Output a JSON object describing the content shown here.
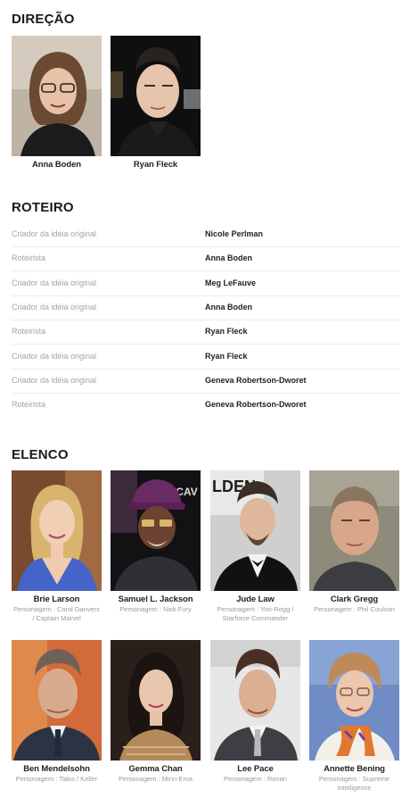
{
  "direction": {
    "title": "DIREÇÃO",
    "people": [
      {
        "name": "Anna Boden"
      },
      {
        "name": "Ryan Fleck"
      }
    ]
  },
  "screenplay": {
    "title": "ROTEIRO",
    "rows": [
      {
        "role": "Criador da idéia original",
        "name": "Nicole Perlman"
      },
      {
        "role": "Roteirista",
        "name": "Anna Boden"
      },
      {
        "role": "Criador da idéia original",
        "name": "Meg LeFauve"
      },
      {
        "role": "Criador da idéia original",
        "name": "Anna Boden"
      },
      {
        "role": "Roteirista",
        "name": "Ryan Fleck"
      },
      {
        "role": "Criador da idéia original",
        "name": "Ryan Fleck"
      },
      {
        "role": "Criador da idéia original",
        "name": "Geneva Robertson-Dworet"
      },
      {
        "role": "Roteirista",
        "name": "Geneva Robertson-Dworet"
      }
    ]
  },
  "cast": {
    "title": "ELENCO",
    "members": [
      {
        "name": "Brie Larson",
        "character": "Personagem : Carol Danvers / Captain Marvel"
      },
      {
        "name": "Samuel L. Jackson",
        "character": "Personagem : Nick Fury"
      },
      {
        "name": "Jude Law",
        "character": "Personagem : Yon-Rogg / Starforce Commander"
      },
      {
        "name": "Clark Gregg",
        "character": "Personagem : Phil Coulson"
      },
      {
        "name": "Ben Mendelsohn",
        "character": "Personagem : Talos / Keller"
      },
      {
        "name": "Gemma Chan",
        "character": "Personagem : Minn-Erva"
      },
      {
        "name": "Lee Pace",
        "character": "Personagem : Ronan"
      },
      {
        "name": "Annette Bening",
        "character": "Personagem : Supreme Intelligence"
      }
    ]
  }
}
